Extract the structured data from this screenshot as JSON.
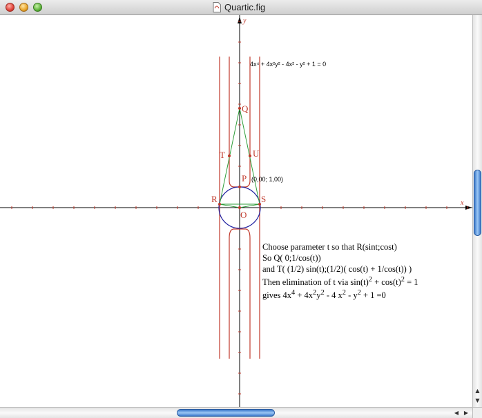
{
  "window": {
    "title": "Quartic.fig"
  },
  "axes": {
    "x_label": "x",
    "y_label": "y"
  },
  "equation_label": "4x⁴ + 4x²y² - 4x² - y² + 1 = 0",
  "points": {
    "Q": "Q",
    "T": "T",
    "U": "U",
    "P": "P",
    "R": "R",
    "S": "S",
    "O": "O"
  },
  "p_coordinates": "(0,00; 1,00)",
  "explanation": {
    "line1": "Choose parameter t so that R(sint;cost)",
    "line2": "So Q( 0;1/cos(t))",
    "line3": "and T( (1/2) sin(t);(1/2)( cos(t) + 1/cos(t)) )",
    "line4_a": "Then elimination of t via sin(t)",
    "line4_sup1": "2",
    "line4_b": " + cos(t)",
    "line4_sup2": "2",
    "line4_c": " = 1",
    "line5_a": "gives 4x",
    "line5_sup1": "4",
    "line5_b": " + 4x",
    "line5_sup2": "2",
    "line5_c": "y",
    "line5_sup3": "2",
    "line5_d": " - 4 x",
    "line5_sup4": "2",
    "line5_e": " - y",
    "line5_sup5": "2",
    "line5_f": " + 1 =0"
  },
  "colors": {
    "curve": "#c0392b",
    "circle": "#2020a0",
    "triangle": "#2e9e3a",
    "axis": "#000000",
    "scroll_thumb": "#3a78c9"
  }
}
